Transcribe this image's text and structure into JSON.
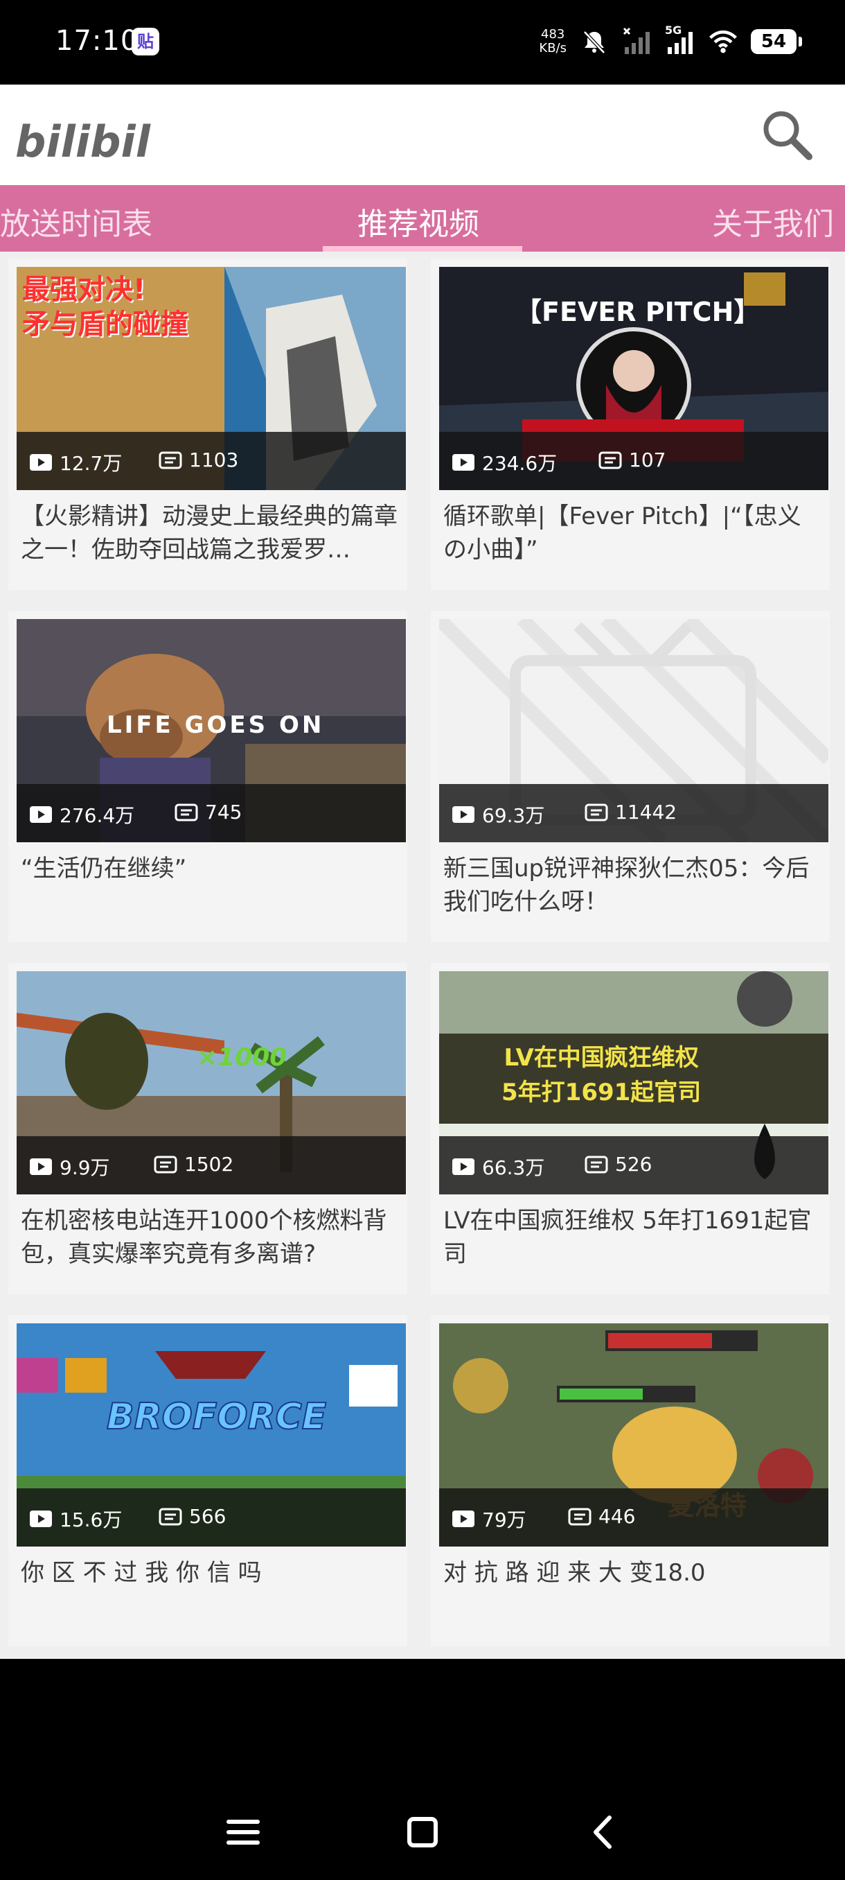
{
  "status_bar": {
    "time": "17:10",
    "app_icon_glyph": "贴",
    "speed_value": "483",
    "speed_unit": "KB/s",
    "network": "5G",
    "battery": "54"
  },
  "header": {
    "logo_text": "bilibili"
  },
  "tabs": [
    {
      "label": "放送时间表",
      "active": false
    },
    {
      "label": "推荐视频",
      "active": true
    },
    {
      "label": "关于我们",
      "active": false
    }
  ],
  "videos": [
    {
      "thumb_text": "最强对决!\n矛与盾的碰撞",
      "views": "12.7万",
      "danmaku": "1103",
      "title": "【火影精讲】动漫史上最经典的篇章之一！佐助夺回战篇之我爱罗…"
    },
    {
      "thumb_text": "【FEVER PITCH】",
      "views": "234.6万",
      "danmaku": "107",
      "title": "循环歌单|【Fever Pitch】|“【忠义の小曲】”"
    },
    {
      "thumb_text": "LIFE GOES ON",
      "views": "276.4万",
      "danmaku": "745",
      "title": "“生活仍在继续”"
    },
    {
      "thumb_text": "",
      "views": "69.3万",
      "danmaku": "11442",
      "title": "新三国up锐评神探狄仁杰05：今后我们吃什么呀！"
    },
    {
      "thumb_text": "×1000",
      "views": "9.9万",
      "danmaku": "1502",
      "title": "在机密核电站连开1000个核燃料背包，真实爆率究竟有多离谱?"
    },
    {
      "thumb_text": "LV在中国疯狂维权\n5年打1691起官司",
      "views": "66.3万",
      "danmaku": "526",
      "title": "LV在中国疯狂维权 5年打1691起官司"
    },
    {
      "thumb_text": "BROFORCE",
      "views": "15.6万",
      "danmaku": "566",
      "title": "你 区 不 过 我 你 信 吗"
    },
    {
      "thumb_text": "夏洛特",
      "views": "79万",
      "danmaku": "446",
      "title": "对 抗 路 迎 来 大 变18.0"
    }
  ],
  "colors": {
    "tab_bar": "#d86e9e",
    "tab_indicator": "#ffc2d8",
    "background": "#f0efef"
  },
  "icons": {
    "views": "play-icon",
    "danmaku": "danmaku-icon",
    "search": "search-icon"
  }
}
